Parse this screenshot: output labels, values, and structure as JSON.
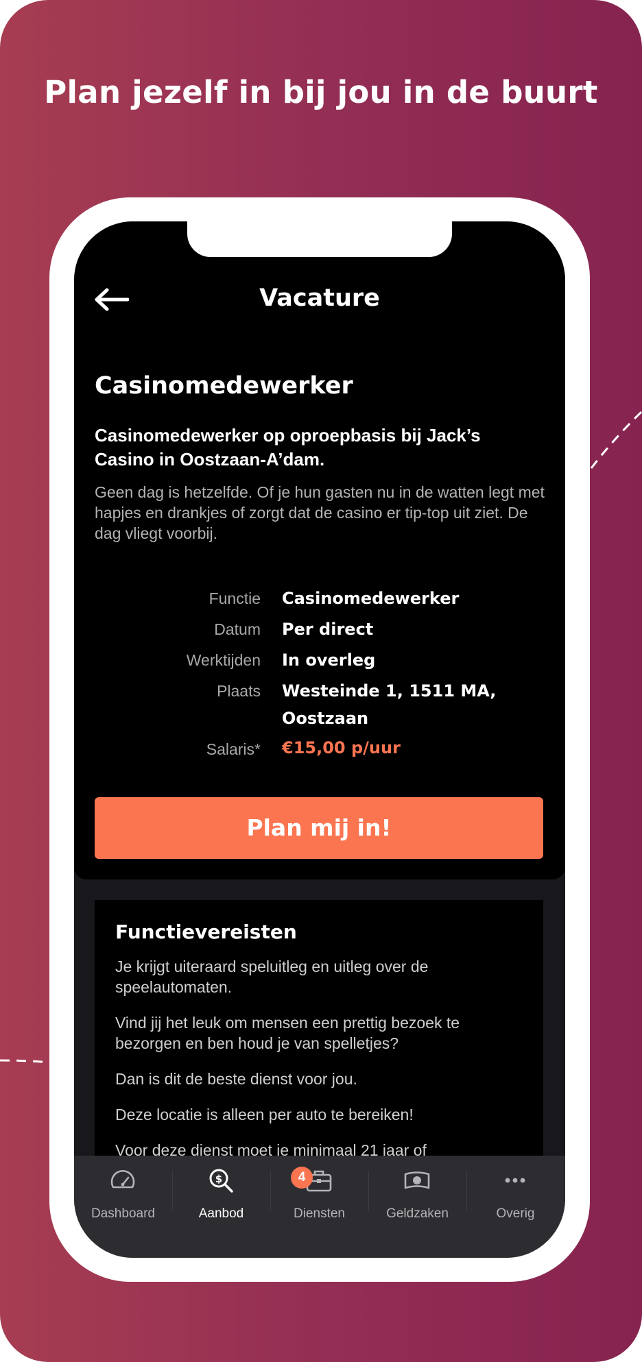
{
  "headline": "Plan jezelf in bij jou in de buurt",
  "header": {
    "title": "Vacature"
  },
  "job": {
    "title": "Casinomedewerker",
    "subtitle": "Casinomedewerker op oproepbasis bij Jack’s Casino in Oostzaan-A’dam.",
    "description": "Geen dag is hetzelfde. Of je hun gasten nu in de watten legt met hapjes en drankjes of zorgt dat de casino er tip-top uit ziet. De dag vliegt voorbij."
  },
  "details": {
    "function_label": "Functie",
    "function_value": "Casinomedewerker",
    "date_label": "Datum",
    "date_value": "Per direct",
    "hours_label": "Werktijden",
    "hours_value": "In overleg",
    "place_label": "Plaats",
    "place_line1": "Westeinde 1, 1511 MA,",
    "place_line2": "Oostzaan",
    "salary_label": "Salaris*",
    "salary_value": "€15,00 p/uur"
  },
  "cta": {
    "label": "Plan mij in!"
  },
  "requirements": {
    "title": "Functievereisten",
    "paragraphs": [
      "Je krijgt uiteraard speluitleg en uitleg over de speelautomaten.",
      "Vind jij het leuk om mensen een prettig bezoek te bezorgen en ben houd je van spelletjes?",
      "Dan is dit de beste dienst voor jou.",
      "Deze locatie is alleen per auto te bereiken!",
      "Voor deze dienst moet je minimaal 21 jaar of"
    ]
  },
  "tabbar": {
    "tabs": [
      {
        "label": "Dashboard",
        "icon": "speedometer-icon",
        "active": false
      },
      {
        "label": "Aanbod",
        "icon": "search-dollar-icon",
        "active": true
      },
      {
        "label": "Diensten",
        "icon": "briefcase-icon",
        "active": false,
        "badge": "4"
      },
      {
        "label": "Geldzaken",
        "icon": "banknote-icon",
        "active": false
      },
      {
        "label": "Overig",
        "icon": "more-dots-icon",
        "active": false
      }
    ]
  },
  "colors": {
    "accent": "#fb7551",
    "background_gradient_start": "#a63d52",
    "background_gradient_end": "#86234f",
    "screen_background": "#000000",
    "tabbar_background": "#2d2d31"
  }
}
